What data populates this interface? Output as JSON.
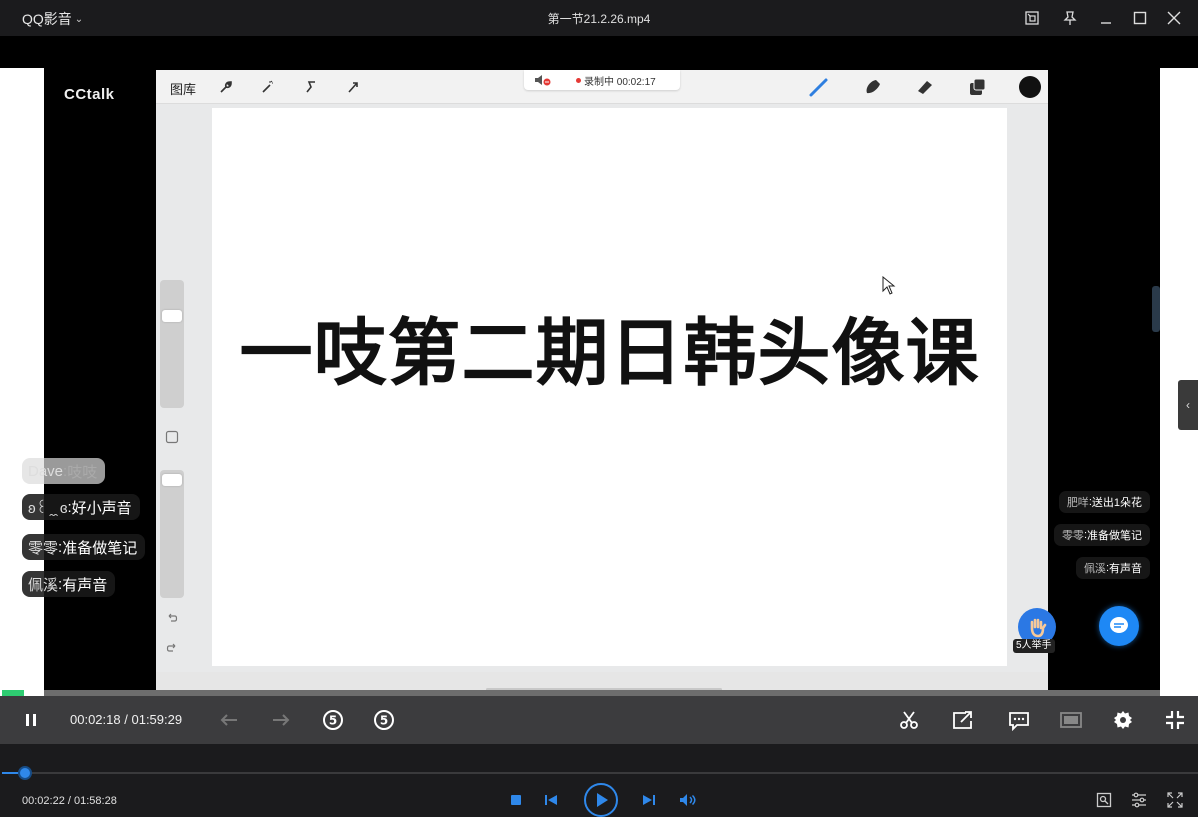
{
  "titlebar": {
    "app_name": "QQ影音",
    "file_title": "第一节21.2.26.mp4"
  },
  "video": {
    "brand": "CCtalk",
    "ipad": {
      "gallery": "图库",
      "recording": "录制中 00:02:17",
      "canvas_text": "一吱第二期日韩头像课"
    },
    "chat_left": [
      {
        "name": "Dave",
        "text": "吱吱",
        "faded": true
      },
      {
        "name": "ʚ꒰ ̯ ̯ ɞ",
        "text": "好小声音"
      },
      {
        "name": "零零",
        "text": "准备做笔记"
      },
      {
        "name": "佩溪",
        "text": "有声音"
      }
    ],
    "chat_right": [
      {
        "name": "肥咩",
        "text": "送出1朵花"
      },
      {
        "name": "零零",
        "text": "准备做笔记"
      },
      {
        "name": "佩溪",
        "text": "有声音"
      }
    ],
    "raise_hand_label": "5人举手"
  },
  "inner_player": {
    "current": "00:02:18",
    "separator": "/",
    "total": "01:59:29"
  },
  "outer_player": {
    "time": "00:02:22 / 01:58:28",
    "progress": 0.0191,
    "accent": "#2f88ea"
  }
}
